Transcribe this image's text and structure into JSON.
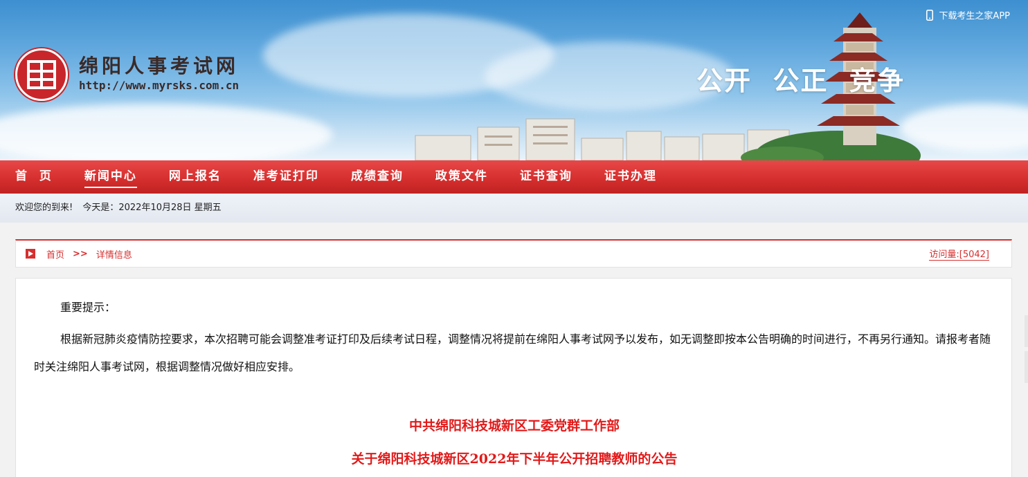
{
  "header": {
    "site_name": "绵阳人事考试网",
    "site_url": "http://www.myrsks.com.cn",
    "slogan": "公开  公正  竞争",
    "download_app": "下载考生之家APP",
    "icons": [
      "logo-seal",
      "phone-icon"
    ]
  },
  "nav": {
    "items": [
      {
        "label": "首  页",
        "active": false
      },
      {
        "label": "新闻中心",
        "active": true
      },
      {
        "label": "网上报名",
        "active": false
      },
      {
        "label": "准考证打印",
        "active": false
      },
      {
        "label": "成绩查询",
        "active": false
      },
      {
        "label": "政策文件",
        "active": false
      },
      {
        "label": "证书查询",
        "active": false
      },
      {
        "label": "证书办理",
        "active": false
      }
    ]
  },
  "welcome": {
    "greeting": "欢迎您的到来!",
    "today": "今天是：2022年10月28日 星期五"
  },
  "breadcrumb": {
    "home": "首页",
    "separator": ">>",
    "current": "详情信息",
    "visits": "访问量:[5042]"
  },
  "content": {
    "notice_title": "重要提示：",
    "notice_body": "根据新冠肺炎疫情防控要求，本次招聘可能会调整准考证打印及后续考试日程，调整情况将提前在绵阳人事考试网予以发布，如无调整即按本公告明确的时间进行，不再另行通知。请报考者随时关注绵阳人事考试网，根据调整情况做好相应安排。",
    "heading_1": "中共绵阳科技城新区工委党群工作部",
    "heading_2": "关于绵阳科技城新区2022年下半年公开招聘教师的公告"
  },
  "colors": {
    "brand_red": "#d62f2f",
    "heading_red": "#e21a1a",
    "sky_blue": "#5ea6dd"
  }
}
